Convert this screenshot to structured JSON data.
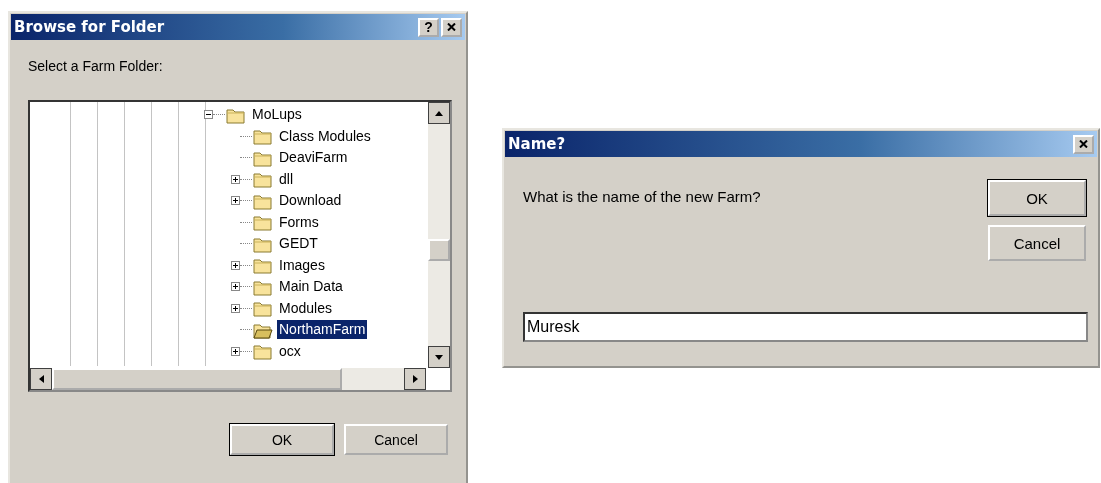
{
  "browse_dialog": {
    "title": "Browse for Folder",
    "title_buttons": [
      {
        "kind": "help",
        "label": "?"
      },
      {
        "kind": "close"
      }
    ],
    "prompt": "Select a Farm Folder:",
    "tree": [
      {
        "name": "MoLups",
        "has_children": true,
        "expanded": true,
        "selected": false,
        "children": [
          {
            "name": "Class Modules",
            "has_children": false,
            "selected": false
          },
          {
            "name": "DeaviFarm",
            "has_children": false,
            "selected": false
          },
          {
            "name": "dll",
            "has_children": true,
            "expanded": false,
            "selected": false
          },
          {
            "name": "Download",
            "has_children": true,
            "expanded": false,
            "selected": false
          },
          {
            "name": "Forms",
            "has_children": false,
            "selected": false
          },
          {
            "name": "GEDT",
            "has_children": false,
            "selected": false
          },
          {
            "name": "Images",
            "has_children": true,
            "expanded": false,
            "selected": false
          },
          {
            "name": "Main Data",
            "has_children": true,
            "expanded": false,
            "selected": false
          },
          {
            "name": "Modules",
            "has_children": true,
            "expanded": false,
            "selected": false
          },
          {
            "name": "NorthamFarm",
            "has_children": false,
            "selected": true
          },
          {
            "name": "ocx",
            "has_children": true,
            "expanded": false,
            "selected": false
          }
        ]
      }
    ],
    "buttons": [
      {
        "label": "OK",
        "default": true
      },
      {
        "label": "Cancel",
        "default": false
      }
    ]
  },
  "name_dialog": {
    "title": "Name?",
    "title_buttons": [
      {
        "kind": "close"
      }
    ],
    "prompt": "What is the name of the new Farm?",
    "buttons": [
      {
        "label": "OK",
        "default": true
      },
      {
        "label": "Cancel",
        "default": false
      }
    ],
    "input": {
      "value": "Muresk"
    }
  }
}
